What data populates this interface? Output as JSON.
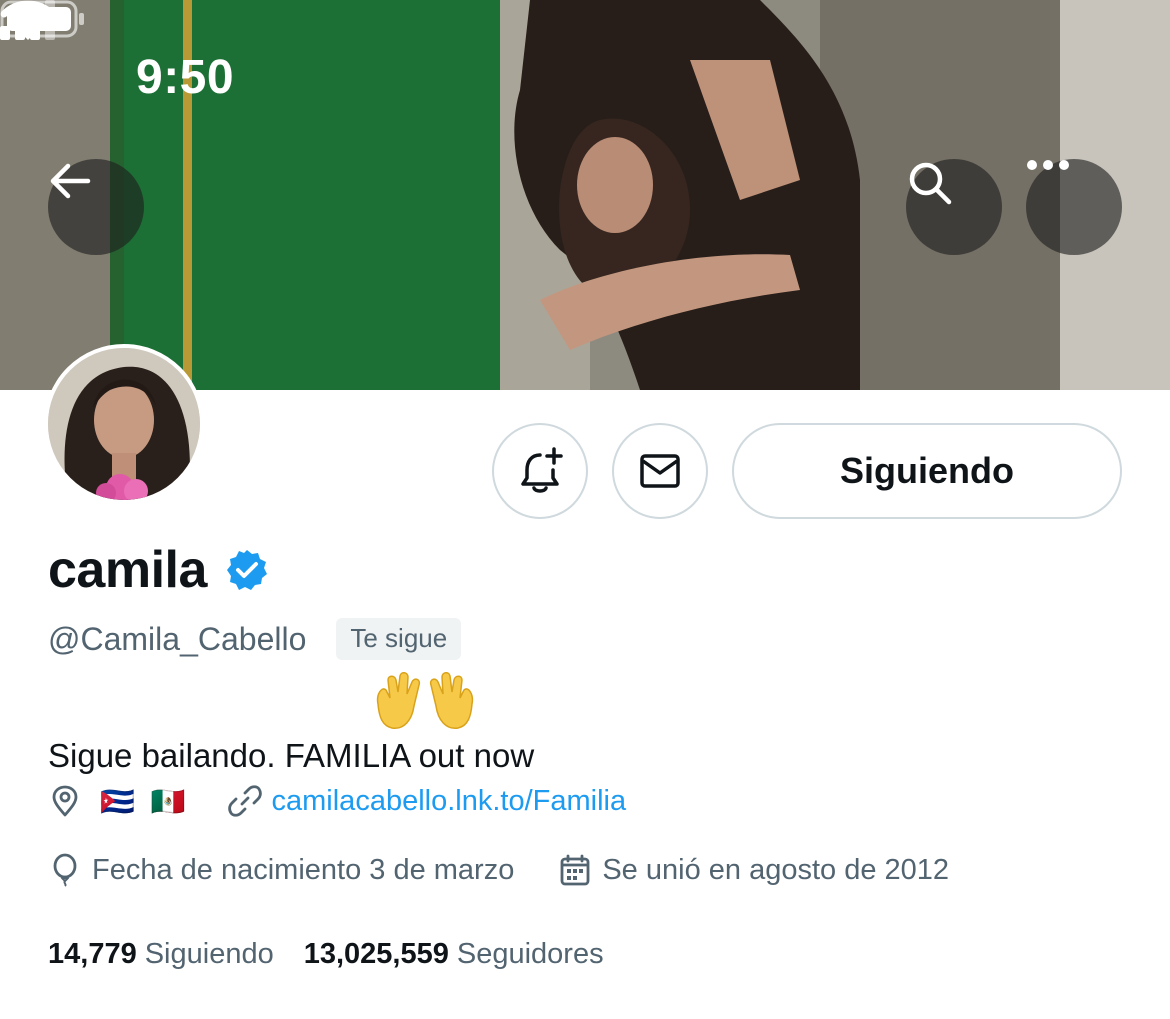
{
  "status_bar": {
    "time": "9:50"
  },
  "profile": {
    "display_name": "camila",
    "handle": "@Camila_Cabello",
    "follows_you_badge": "Te sigue",
    "bio_emoji": "🙌",
    "bio": "Sigue bailando. FAMILIA out now",
    "location_flags": "🇨🇺 🇲🇽",
    "website": "camilacabello.lnk.to/Familia",
    "birthday": "Fecha de nacimiento 3 de marzo",
    "joined": "Se unió en agosto de 2012"
  },
  "actions": {
    "follow_button_label": "Siguiendo"
  },
  "stats": {
    "following_count": "14,779",
    "following_label": "Siguiendo",
    "followers_count": "13,025,559",
    "followers_label": "Seguidores"
  },
  "icons": {
    "back": "arrow-left-icon",
    "search": "search-icon",
    "more": "more-horizontal-icon",
    "notify": "bell-plus-icon",
    "message": "envelope-icon",
    "verified": "verified-badge-icon",
    "location": "location-pin-icon",
    "link": "link-icon",
    "birthday": "balloon-icon",
    "joined": "calendar-icon"
  },
  "colors": {
    "accent": "#1d9bf0",
    "text_primary": "#0f1419",
    "text_secondary": "#536471",
    "border": "#cfd9de",
    "badge_bg": "#eff3f4"
  }
}
